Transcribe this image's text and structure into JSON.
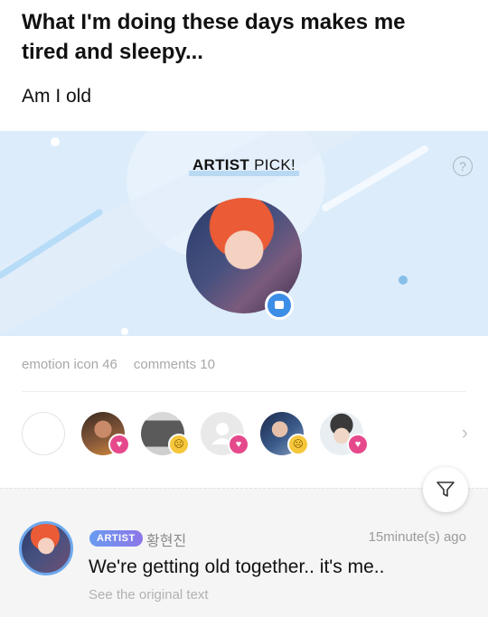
{
  "post": {
    "title": "What I'm doing these days makes me tired and sleepy...",
    "body": "Am I old"
  },
  "artist_pick": {
    "title_bold": "ARTIST",
    "title_rest": " PICK!",
    "help_icon": "question-mark-icon",
    "badge_icon": "chat-bubble-icon",
    "accent_color": "#3d8ee6",
    "background_color": "#dcecfa"
  },
  "stats": {
    "emotion_label": "emotion icon 46",
    "comments_label": "comments 10"
  },
  "reactions": [
    {
      "avatar": "empty",
      "badge": ""
    },
    {
      "avatar": "user-avatar",
      "badge": "heart",
      "badge_glyph": "♥"
    },
    {
      "avatar": "user-avatar",
      "badge": "sad",
      "badge_glyph": "☹"
    },
    {
      "avatar": "default-avatar",
      "badge": "heart",
      "badge_glyph": "♥"
    },
    {
      "avatar": "user-avatar",
      "badge": "sad",
      "badge_glyph": "☹"
    },
    {
      "avatar": "user-avatar",
      "badge": "heart",
      "badge_glyph": "♥"
    }
  ],
  "reactions_next_glyph": "›",
  "comment": {
    "role_badge": "ARTIST",
    "author": "황현진",
    "time": "15minute(s) ago",
    "text": "We're getting old together.. it's me..",
    "original_link": "See the original text"
  },
  "colors": {
    "heart": "#e5498b",
    "sad": "#f6c63b",
    "artist_chip_start": "#6a9bf0",
    "artist_chip_end": "#8c76e8"
  }
}
